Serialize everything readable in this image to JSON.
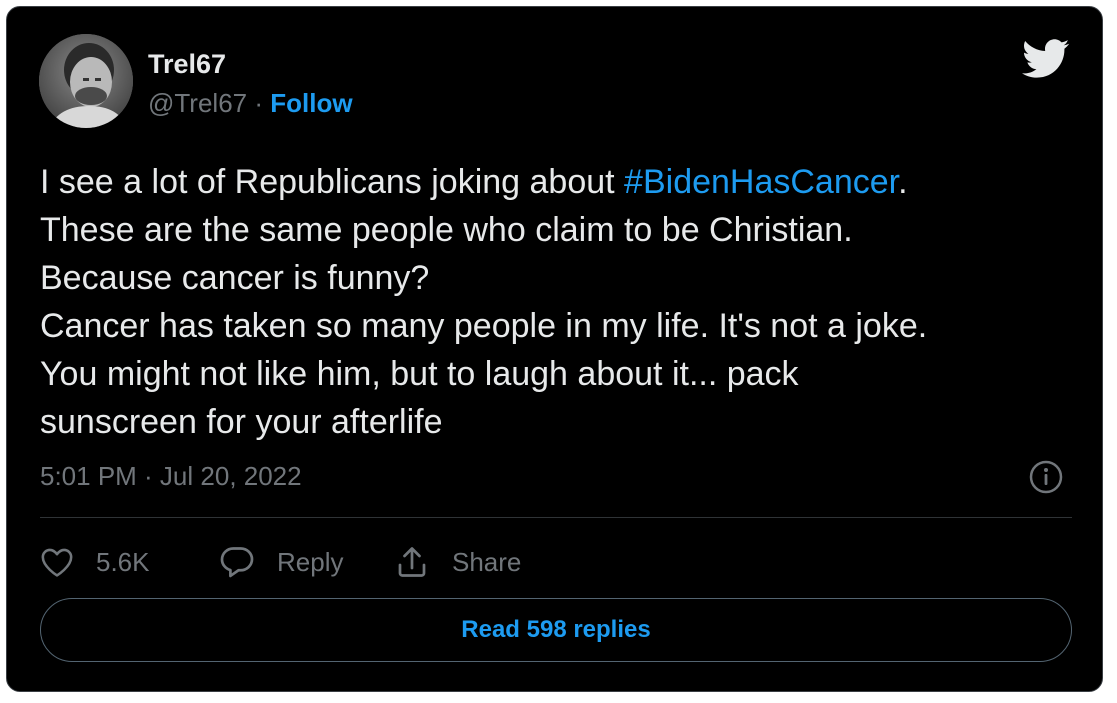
{
  "author": {
    "name": "Trel67",
    "handle": "@Trel67",
    "separator": "·",
    "follow_label": "Follow"
  },
  "tweet": {
    "line1_prefix": "I see a lot of Republicans joking about ",
    "line1_hashtag": "#BidenHasCancer",
    "line1_suffix": ".",
    "line2": "These are the same people who claim to be Christian.",
    "line3": "Because cancer is funny?",
    "line4": "Cancer has taken so many people in my life. It's not a joke.",
    "line5": "You might not like him, but to laugh about it... pack",
    "line6": "sunscreen for your afterlife"
  },
  "meta": {
    "timestamp": "5:01 PM · Jul 20, 2022"
  },
  "actions": {
    "likes": "5.6K",
    "reply_label": "Reply",
    "share_label": "Share"
  },
  "read_replies_label": "Read 598 replies",
  "colors": {
    "background": "#000000",
    "text": "#e7e9ea",
    "muted": "#71767b",
    "accent": "#1d9bf0"
  },
  "icons": [
    "twitter-bird-icon",
    "info-icon",
    "heart-icon",
    "reply-bubble-icon",
    "share-icon"
  ]
}
